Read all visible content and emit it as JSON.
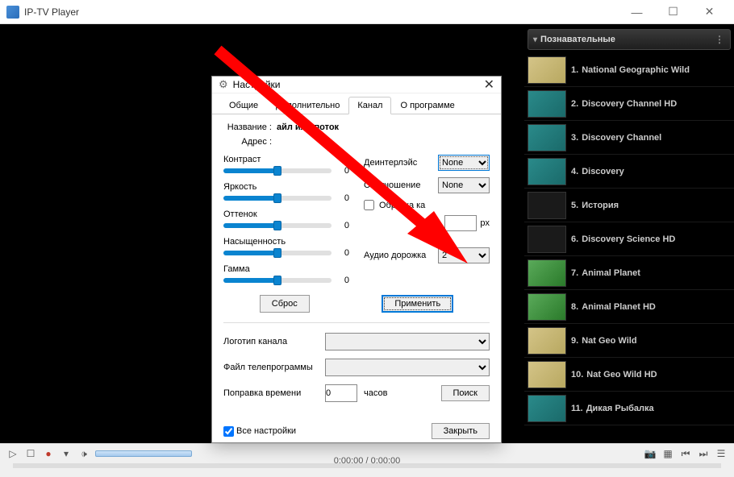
{
  "app": {
    "title": "IP-TV Player"
  },
  "window_buttons": {
    "minimize": "—",
    "maximize": "☐",
    "close": "✕"
  },
  "playlist": {
    "category": "Познавательные",
    "items": [
      {
        "num": "1.",
        "name": "National Geographic Wild",
        "thumb": "yellow"
      },
      {
        "num": "2.",
        "name": "Discovery Channel HD",
        "thumb": "teal"
      },
      {
        "num": "3.",
        "name": "Discovery Channel",
        "thumb": "teal"
      },
      {
        "num": "4.",
        "name": "Discovery",
        "thumb": "teal"
      },
      {
        "num": "5.",
        "name": "История",
        "thumb": "dark"
      },
      {
        "num": "6.",
        "name": "Discovery Science HD",
        "thumb": "dark"
      },
      {
        "num": "7.",
        "name": "Animal Planet",
        "thumb": "green"
      },
      {
        "num": "8.",
        "name": "Animal Planet HD",
        "thumb": "green"
      },
      {
        "num": "9.",
        "name": "Nat Geo Wild",
        "thumb": "yellow"
      },
      {
        "num": "10.",
        "name": "Nat Geo Wild HD",
        "thumb": "yellow"
      },
      {
        "num": "11.",
        "name": "Дикая Рыбалка",
        "thumb": "teal"
      }
    ]
  },
  "dialog": {
    "title": "Настройки",
    "tabs": {
      "general": "Общие",
      "extra": "Дополнительно",
      "channel": "Канал",
      "about": "О программе"
    },
    "name_label": "Название :",
    "name_value": "айл или поток",
    "addr_label": "Адрес :",
    "sliders": {
      "contrast": {
        "label": "Контраст",
        "value": "0"
      },
      "brightness": {
        "label": "Яркость",
        "value": "0"
      },
      "hue": {
        "label": "Оттенок",
        "value": "0"
      },
      "saturation": {
        "label": "Насыщенность",
        "value": "0"
      },
      "gamma": {
        "label": "Гамма",
        "value": "0"
      }
    },
    "deinterlace": {
      "label": "Деинтерлэйс",
      "value": "None"
    },
    "aspect": {
      "label": "Соотношение",
      "value": "None"
    },
    "crop": {
      "label": "Обрезка ка"
    },
    "px_suffix": "px",
    "audio": {
      "label": "Аудио дорожка",
      "value": "2"
    },
    "reset": "Сброс",
    "apply": "Применить",
    "logo": "Логотип канала",
    "tvguide": "Файл телепрограммы",
    "timefix": "Поправка времени",
    "timefix_value": "0",
    "hours": "часов",
    "search": "Поиск",
    "all_settings": "Все настройки",
    "close": "Закрыть"
  },
  "controls": {
    "time": "0:00:00 / 0:00:00"
  }
}
